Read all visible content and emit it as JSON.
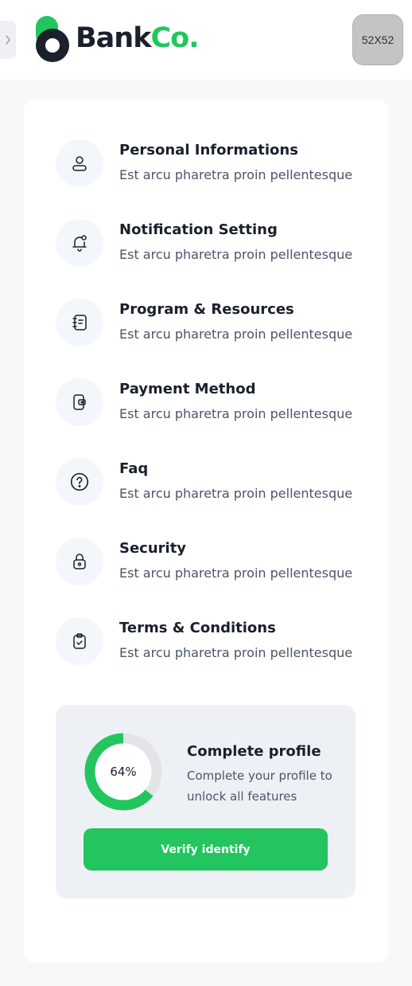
{
  "header": {
    "logo_text_main": "Bank",
    "logo_text_accent": "Co.",
    "avatar_placeholder": "52X52",
    "brand_color": "#22c55e"
  },
  "menu": {
    "items": [
      {
        "icon": "user-icon",
        "title": "Personal Informations",
        "description": "Est arcu pharetra proin pellentesque"
      },
      {
        "icon": "bell-icon",
        "title": "Notification Setting",
        "description": "Est arcu pharetra proin pellentesque"
      },
      {
        "icon": "notebook-icon",
        "title": "Program & Resources",
        "description": "Est arcu pharetra proin pellentesque"
      },
      {
        "icon": "wallet-icon",
        "title": "Payment Method",
        "description": "Est arcu pharetra proin pellentesque"
      },
      {
        "icon": "question-icon",
        "title": "Faq",
        "description": "Est arcu pharetra proin pellentesque"
      },
      {
        "icon": "lock-icon",
        "title": "Security",
        "description": "Est arcu pharetra proin pellentesque"
      },
      {
        "icon": "clipboard-check-icon",
        "title": "Terms & Conditions",
        "description": "Est arcu pharetra proin pellentesque"
      }
    ]
  },
  "profile": {
    "progress_label": "64%",
    "progress_fraction": 0.64,
    "title": "Complete profile",
    "description": "Complete your profile to unlock all features",
    "button_label": "Verify identify",
    "progress_color": "#22c55e",
    "track_color": "#e2e4e7"
  }
}
